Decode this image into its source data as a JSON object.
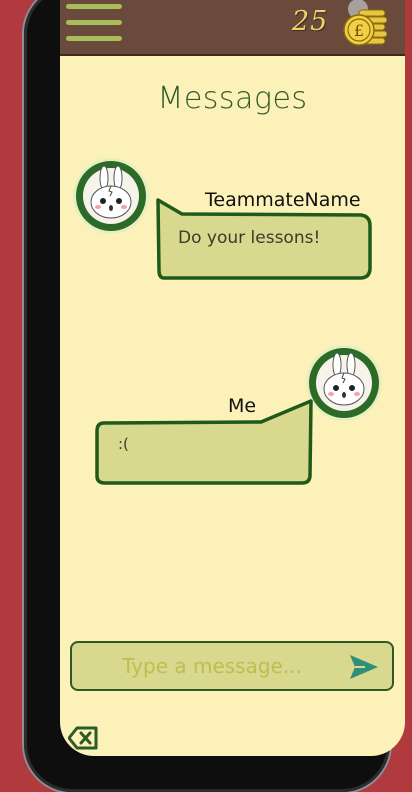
{
  "topbar": {
    "menu_icon": "hamburger-menu-icon",
    "coins": "25",
    "coin_icon": "pound-coins-icon"
  },
  "page": {
    "title": "Messages"
  },
  "messages": [
    {
      "sender": "TeammateName",
      "text": "Do your lessons!",
      "avatar": "bunny-avatar"
    },
    {
      "sender": "Me",
      "text": ":(",
      "avatar": "bunny-avatar"
    }
  ],
  "composer": {
    "placeholder": "Type a message...",
    "send_icon": "send-icon"
  },
  "footer": {
    "back_icon": "backspace-icon"
  },
  "colors": {
    "frame_bg": "#b03a3e",
    "screen_bg": "#fbf1b9",
    "topbar_bg": "#6a4a3a",
    "accent_green": "#2d5a27",
    "bubble_fill": "#d8d88e",
    "coin_gold": "#e8c640"
  }
}
